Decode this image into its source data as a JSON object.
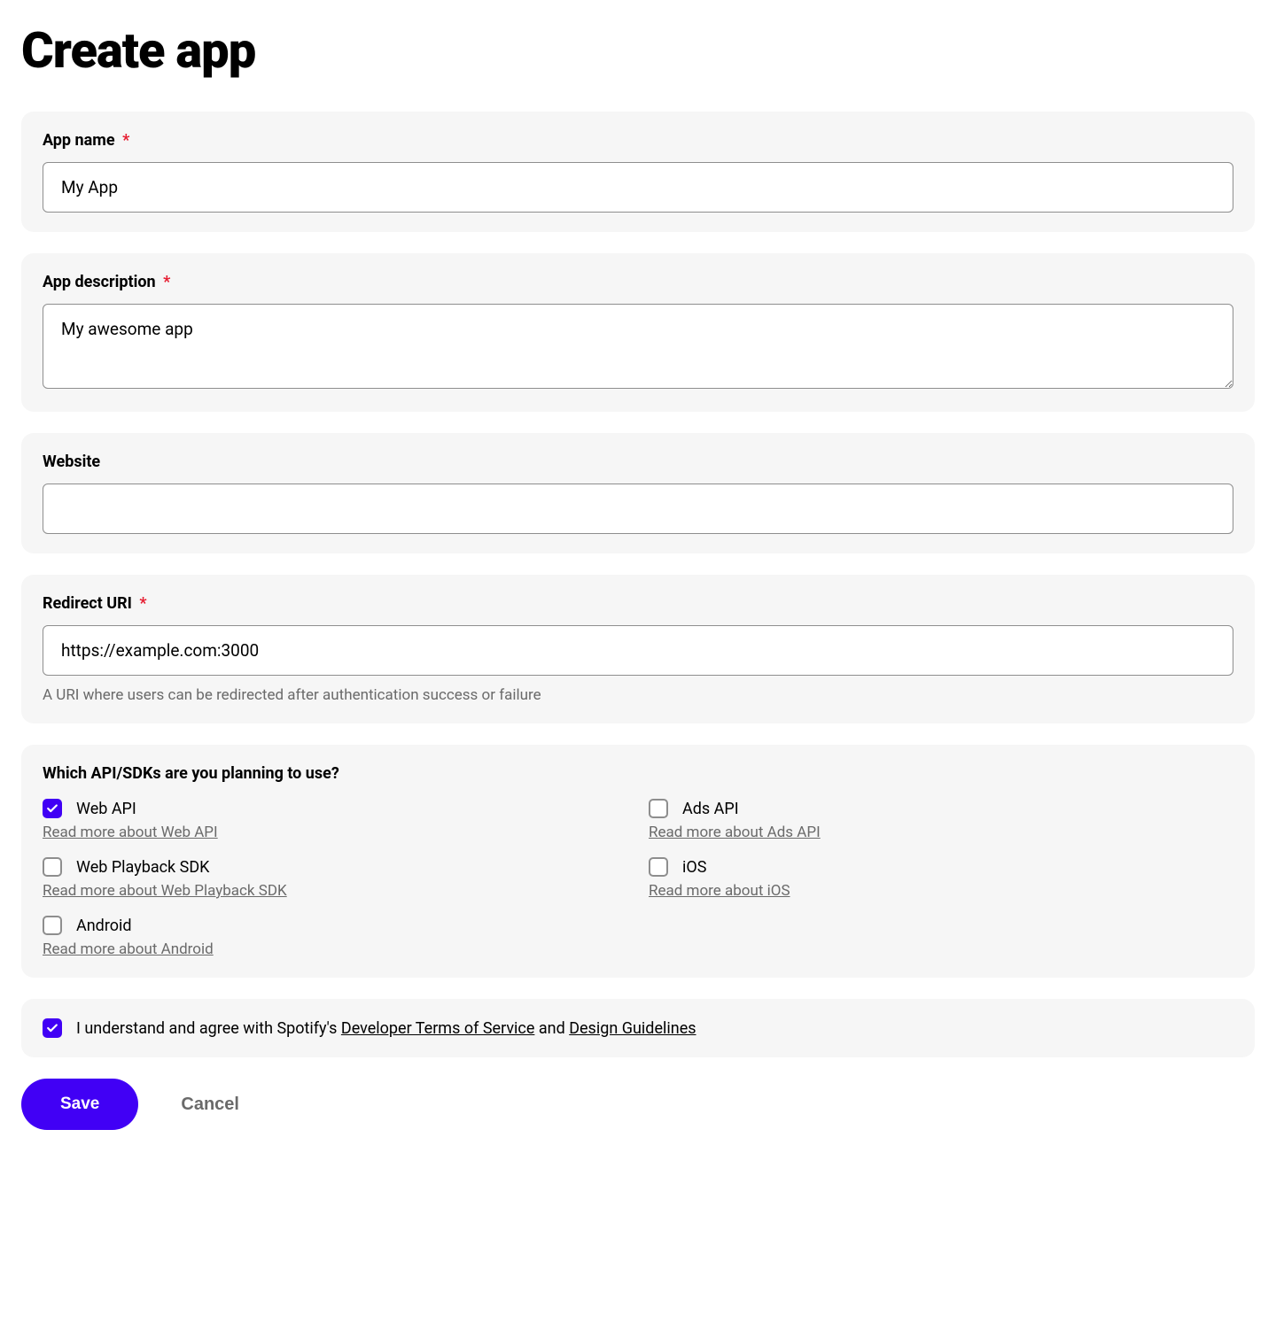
{
  "page": {
    "title": "Create app"
  },
  "fields": {
    "app_name": {
      "label": "App name",
      "required": true,
      "value": "My App"
    },
    "app_description": {
      "label": "App description",
      "required": true,
      "value": "My awesome app"
    },
    "website": {
      "label": "Website",
      "required": false,
      "value": ""
    },
    "redirect_uri": {
      "label": "Redirect URI",
      "required": true,
      "value": "https://example.com:3000",
      "helper": "A URI where users can be redirected after authentication success or failure"
    }
  },
  "sdks": {
    "heading": "Which API/SDKs are you planning to use?",
    "items": [
      {
        "id": "web-api",
        "label": "Web API",
        "read_more": "Read more about Web API",
        "checked": true
      },
      {
        "id": "ads-api",
        "label": "Ads API",
        "read_more": "Read more about Ads API",
        "checked": false
      },
      {
        "id": "web-playback-sdk",
        "label": "Web Playback SDK",
        "read_more": "Read more about Web Playback SDK",
        "checked": false
      },
      {
        "id": "ios",
        "label": "iOS",
        "read_more": "Read more about iOS",
        "checked": false
      },
      {
        "id": "android",
        "label": "Android",
        "read_more": "Read more about Android",
        "checked": false
      }
    ]
  },
  "terms": {
    "checked": true,
    "prefix": "I understand and agree with Spotify's ",
    "link1": "Developer Terms of Service",
    "middle": " and ",
    "link2": "Design Guidelines"
  },
  "buttons": {
    "save": "Save",
    "cancel": "Cancel"
  },
  "required_symbol": "*"
}
